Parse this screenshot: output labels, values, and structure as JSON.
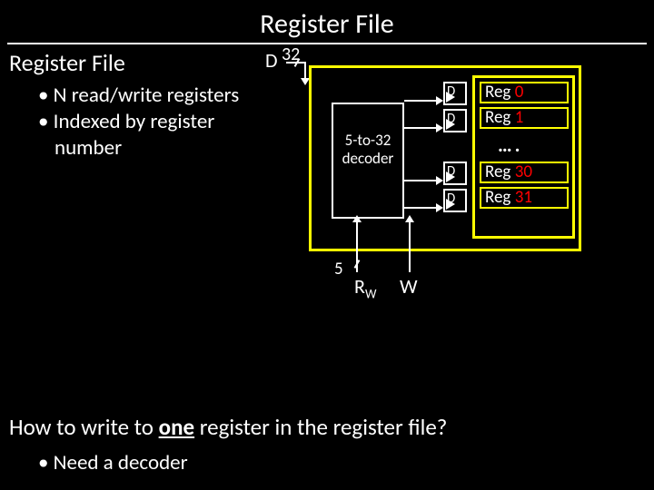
{
  "title": "Register File",
  "subtitle": "Register File",
  "bullets": [
    "N read/write registers",
    "Indexed by register number"
  ],
  "question_prefix": "How to write to ",
  "question_emph": "one",
  "question_suffix": " register in the register file?",
  "answer_bullets": [
    "Need a decoder"
  ],
  "diagram": {
    "d_in": "D",
    "d_hint": "D",
    "width_d": "32",
    "decoder_l1": "5-to-32",
    "decoder_l2": "decoder",
    "rw_bits": "5",
    "rw_label": "R",
    "rw_sub": "W",
    "w_label": "W",
    "reg_prefix": "Reg ",
    "reg0": "0",
    "reg1": "1",
    "reg30": "30",
    "reg31": "31",
    "dots": "…."
  }
}
